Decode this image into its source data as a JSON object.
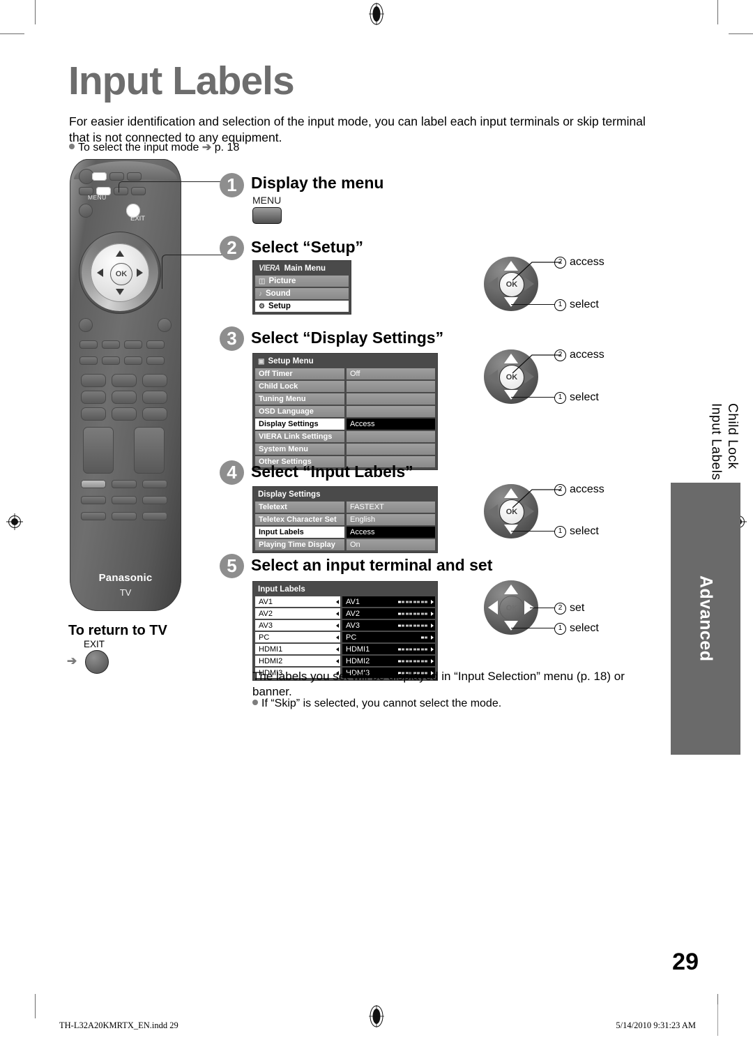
{
  "page": {
    "title": "Input Labels",
    "intro": "For easier identification and selection of the input mode, you can label each input terminals or skip terminal that is not connected to any equipment.",
    "bullet": "To select the input mode",
    "bullet_ref": "p. 18",
    "page_number": "29"
  },
  "remote": {
    "menu_label": "MENU",
    "exit_label": "EXIT",
    "ok_label": "OK",
    "brand": "Panasonic",
    "brand_sub": "TV"
  },
  "steps": [
    {
      "num": "1",
      "heading": "Display the menu"
    },
    {
      "num": "2",
      "heading": "Select “Setup”"
    },
    {
      "num": "3",
      "heading": "Select “Display Settings”"
    },
    {
      "num": "4",
      "heading": "Select “Input Labels”"
    },
    {
      "num": "5",
      "heading": "Select an input terminal and set"
    }
  ],
  "menu_key": {
    "label": "MENU"
  },
  "osd_main_menu": {
    "brand": "VIERA",
    "title": "Main Menu",
    "items": [
      {
        "label": "Picture",
        "icon": "picture-icon",
        "selected": false
      },
      {
        "label": "Sound",
        "icon": "sound-icon",
        "selected": false
      },
      {
        "label": "Setup",
        "icon": "setup-icon",
        "selected": true
      }
    ]
  },
  "osd_setup_menu": {
    "title": "Setup Menu",
    "icon": "setup-icon",
    "rows": [
      {
        "name": "Off Timer",
        "value": "Off",
        "selected": false
      },
      {
        "name": "Child Lock",
        "value": "",
        "selected": false
      },
      {
        "name": "Tuning Menu",
        "value": "",
        "selected": false
      },
      {
        "name": "OSD Language",
        "value": "",
        "selected": false
      },
      {
        "name": "Display Settings",
        "value": "Access",
        "selected": true
      },
      {
        "name": "VIERA Link Settings",
        "value": "",
        "selected": false
      },
      {
        "name": "System Menu",
        "value": "",
        "selected": false
      },
      {
        "name": "Other Settings",
        "value": "",
        "selected": false
      }
    ]
  },
  "osd_display_settings": {
    "title": "Display Settings",
    "rows": [
      {
        "name": "Teletext",
        "value": "FASTEXT",
        "selected": false
      },
      {
        "name": "Teletex Character Set",
        "value": "English",
        "selected": false
      },
      {
        "name": "Input Labels",
        "value": "Access",
        "selected": true
      },
      {
        "name": "Playing Time Display",
        "value": "On",
        "selected": false
      }
    ]
  },
  "osd_input_labels": {
    "title": "Input Labels",
    "rows": [
      {
        "terminal": "AV1",
        "label": "AV1",
        "indicator_filled": 1,
        "indicator_total": 8
      },
      {
        "terminal": "AV2",
        "label": "AV2",
        "indicator_filled": 1,
        "indicator_total": 8
      },
      {
        "terminal": "AV3",
        "label": "AV3",
        "indicator_filled": 1,
        "indicator_total": 8
      },
      {
        "terminal": "PC",
        "label": "PC",
        "indicator_filled": 1,
        "indicator_total": 2
      },
      {
        "terminal": "HDMI1",
        "label": "HDMI1",
        "indicator_filled": 1,
        "indicator_total": 8
      },
      {
        "terminal": "HDMI2",
        "label": "HDMI2",
        "indicator_filled": 1,
        "indicator_total": 8
      },
      {
        "terminal": "HDMI3",
        "label": "HDMI3",
        "indicator_filled": 1,
        "indicator_total": 8
      }
    ]
  },
  "navpads": [
    {
      "id": "navpad-step2",
      "ok_label": "OK",
      "callouts": [
        {
          "num": "②",
          "text": "access"
        },
        {
          "num": "①",
          "text": "select"
        }
      ]
    },
    {
      "id": "navpad-step3",
      "ok_label": "OK",
      "callouts": [
        {
          "num": "②",
          "text": "access"
        },
        {
          "num": "①",
          "text": "select"
        }
      ]
    },
    {
      "id": "navpad-step4",
      "ok_label": "OK",
      "callouts": [
        {
          "num": "②",
          "text": "access"
        },
        {
          "num": "①",
          "text": "select"
        }
      ]
    },
    {
      "id": "navpad-step5",
      "ok_label": "OK",
      "callouts": [
        {
          "num": "②",
          "text": "set"
        },
        {
          "num": "①",
          "text": "select"
        }
      ]
    }
  ],
  "return_to_tv": {
    "heading": "To return to TV",
    "button_label": "EXIT"
  },
  "after_note": {
    "text": "The labels you set will be displayed in “Input Selection” menu (p. 18) or banner.",
    "bullet": "If “Skip” is selected, you cannot select the mode."
  },
  "side_tab": {
    "line1": "Child Lock",
    "line2": "Input Labels",
    "section": "Advanced"
  },
  "footer": {
    "file": "TH-L32A20KMRTX_EN.indd   29",
    "timestamp": "5/14/2010   9:31:23 AM"
  },
  "colors": {
    "title_gray": "#6d6d6d",
    "step_circle": "#8e8e8e",
    "side_tab": "#6a6a6a",
    "osd_frame": "#4a4a4a",
    "osd_row": "#97979 7"
  }
}
